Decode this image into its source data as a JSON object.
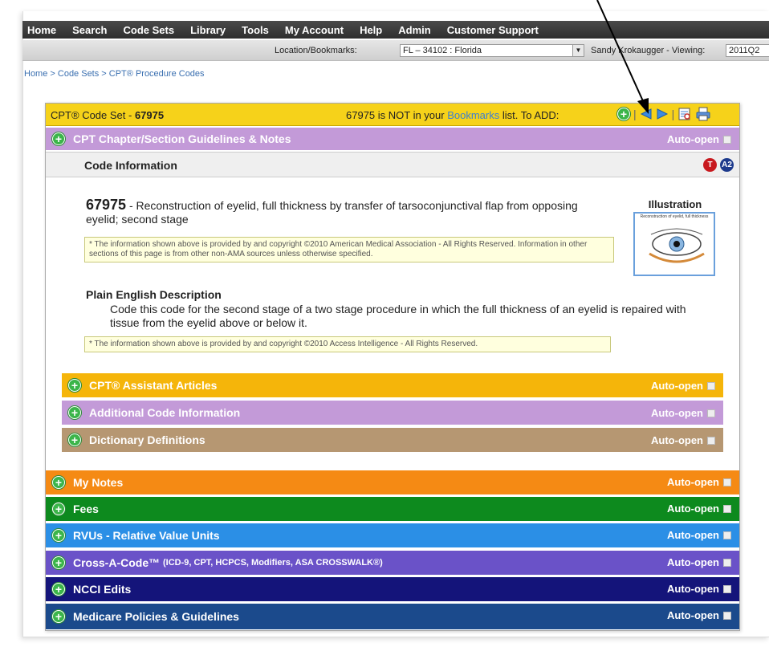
{
  "nav": {
    "items": [
      "Home",
      "Search",
      "Code Sets",
      "Library",
      "Tools",
      "My Account",
      "Help",
      "Admin",
      "Customer Support"
    ]
  },
  "location": {
    "label": "Location/Bookmarks:",
    "value": "FL – 34102 : Florida",
    "user_text": "Sandy Krokaugger - Viewing:",
    "viewing": "2011Q2"
  },
  "breadcrumb": "Home > Code Sets > CPT® Procedure Codes",
  "codeset": {
    "title_prefix": "CPT® Code Set - ",
    "code": "67975",
    "msg_prefix": "67975 is NOT in your ",
    "msg_link": "Bookmarks",
    "msg_suffix": " list. To ADD:"
  },
  "sections": {
    "guidelines": "CPT Chapter/Section Guidelines & Notes",
    "auto_open": "Auto-open",
    "code_info": "Code Information"
  },
  "badges": [
    "T",
    "A2"
  ],
  "code_detail": {
    "code": "67975",
    "description": " - Reconstruction of eyelid, full thickness by transfer of tarsoconjunctival flap from opposing eyelid; second stage",
    "ama_note": "* The information shown above is provided by and copyright ©2010 American Medical Association - All Rights Reserved.  Information in other sections of this page is from other non-AMA sources unless otherwise specified."
  },
  "illustration": {
    "title": "Illustration",
    "caption": "Reconstruction of eyelid, full thickness"
  },
  "plain_english": {
    "title": "Plain English Description",
    "text": "Code this code for the second stage of a two stage procedure in which the full thickness of an eyelid is repaired with tissue from the eyelid above or below it.",
    "note": "* The information shown above is provided by and copyright ©2010 Access Intelligence - All Rights Reserved."
  },
  "sub_sections": [
    {
      "label": "CPT® Assistant Articles",
      "color": "#f5b50a"
    },
    {
      "label": "Additional Code Information",
      "color": "#c39ad8"
    },
    {
      "label": "Dictionary Definitions",
      "color": "#b69772"
    }
  ],
  "bottom_sections": [
    {
      "label": "My Notes",
      "color": "#f58a14"
    },
    {
      "label": "Fees",
      "color": "#0d8a1e"
    },
    {
      "label": "RVUs - Relative Value Units",
      "color": "#2b8fe6"
    },
    {
      "label": "Cross-A-Code™",
      "extra": "(ICD-9, CPT, HCPCS, Modifiers, ASA CROSSWALK®)",
      "color": "#6a52c8"
    },
    {
      "label": "NCCI Edits",
      "color": "#14147a"
    },
    {
      "label": "Medicare Policies & Guidelines",
      "color": "#1b4a8c"
    }
  ],
  "colors": {
    "codeset_bar": "#f6d21a",
    "guidelines_bar": "#c39ad8",
    "link": "#3c7fd0",
    "plus": "#3bb54a"
  },
  "icons": [
    "plus-icon",
    "prev-arrow-icon",
    "next-arrow-icon",
    "notes-icon",
    "print-icon",
    "checkbox-icon",
    "dropdown-icon"
  ]
}
